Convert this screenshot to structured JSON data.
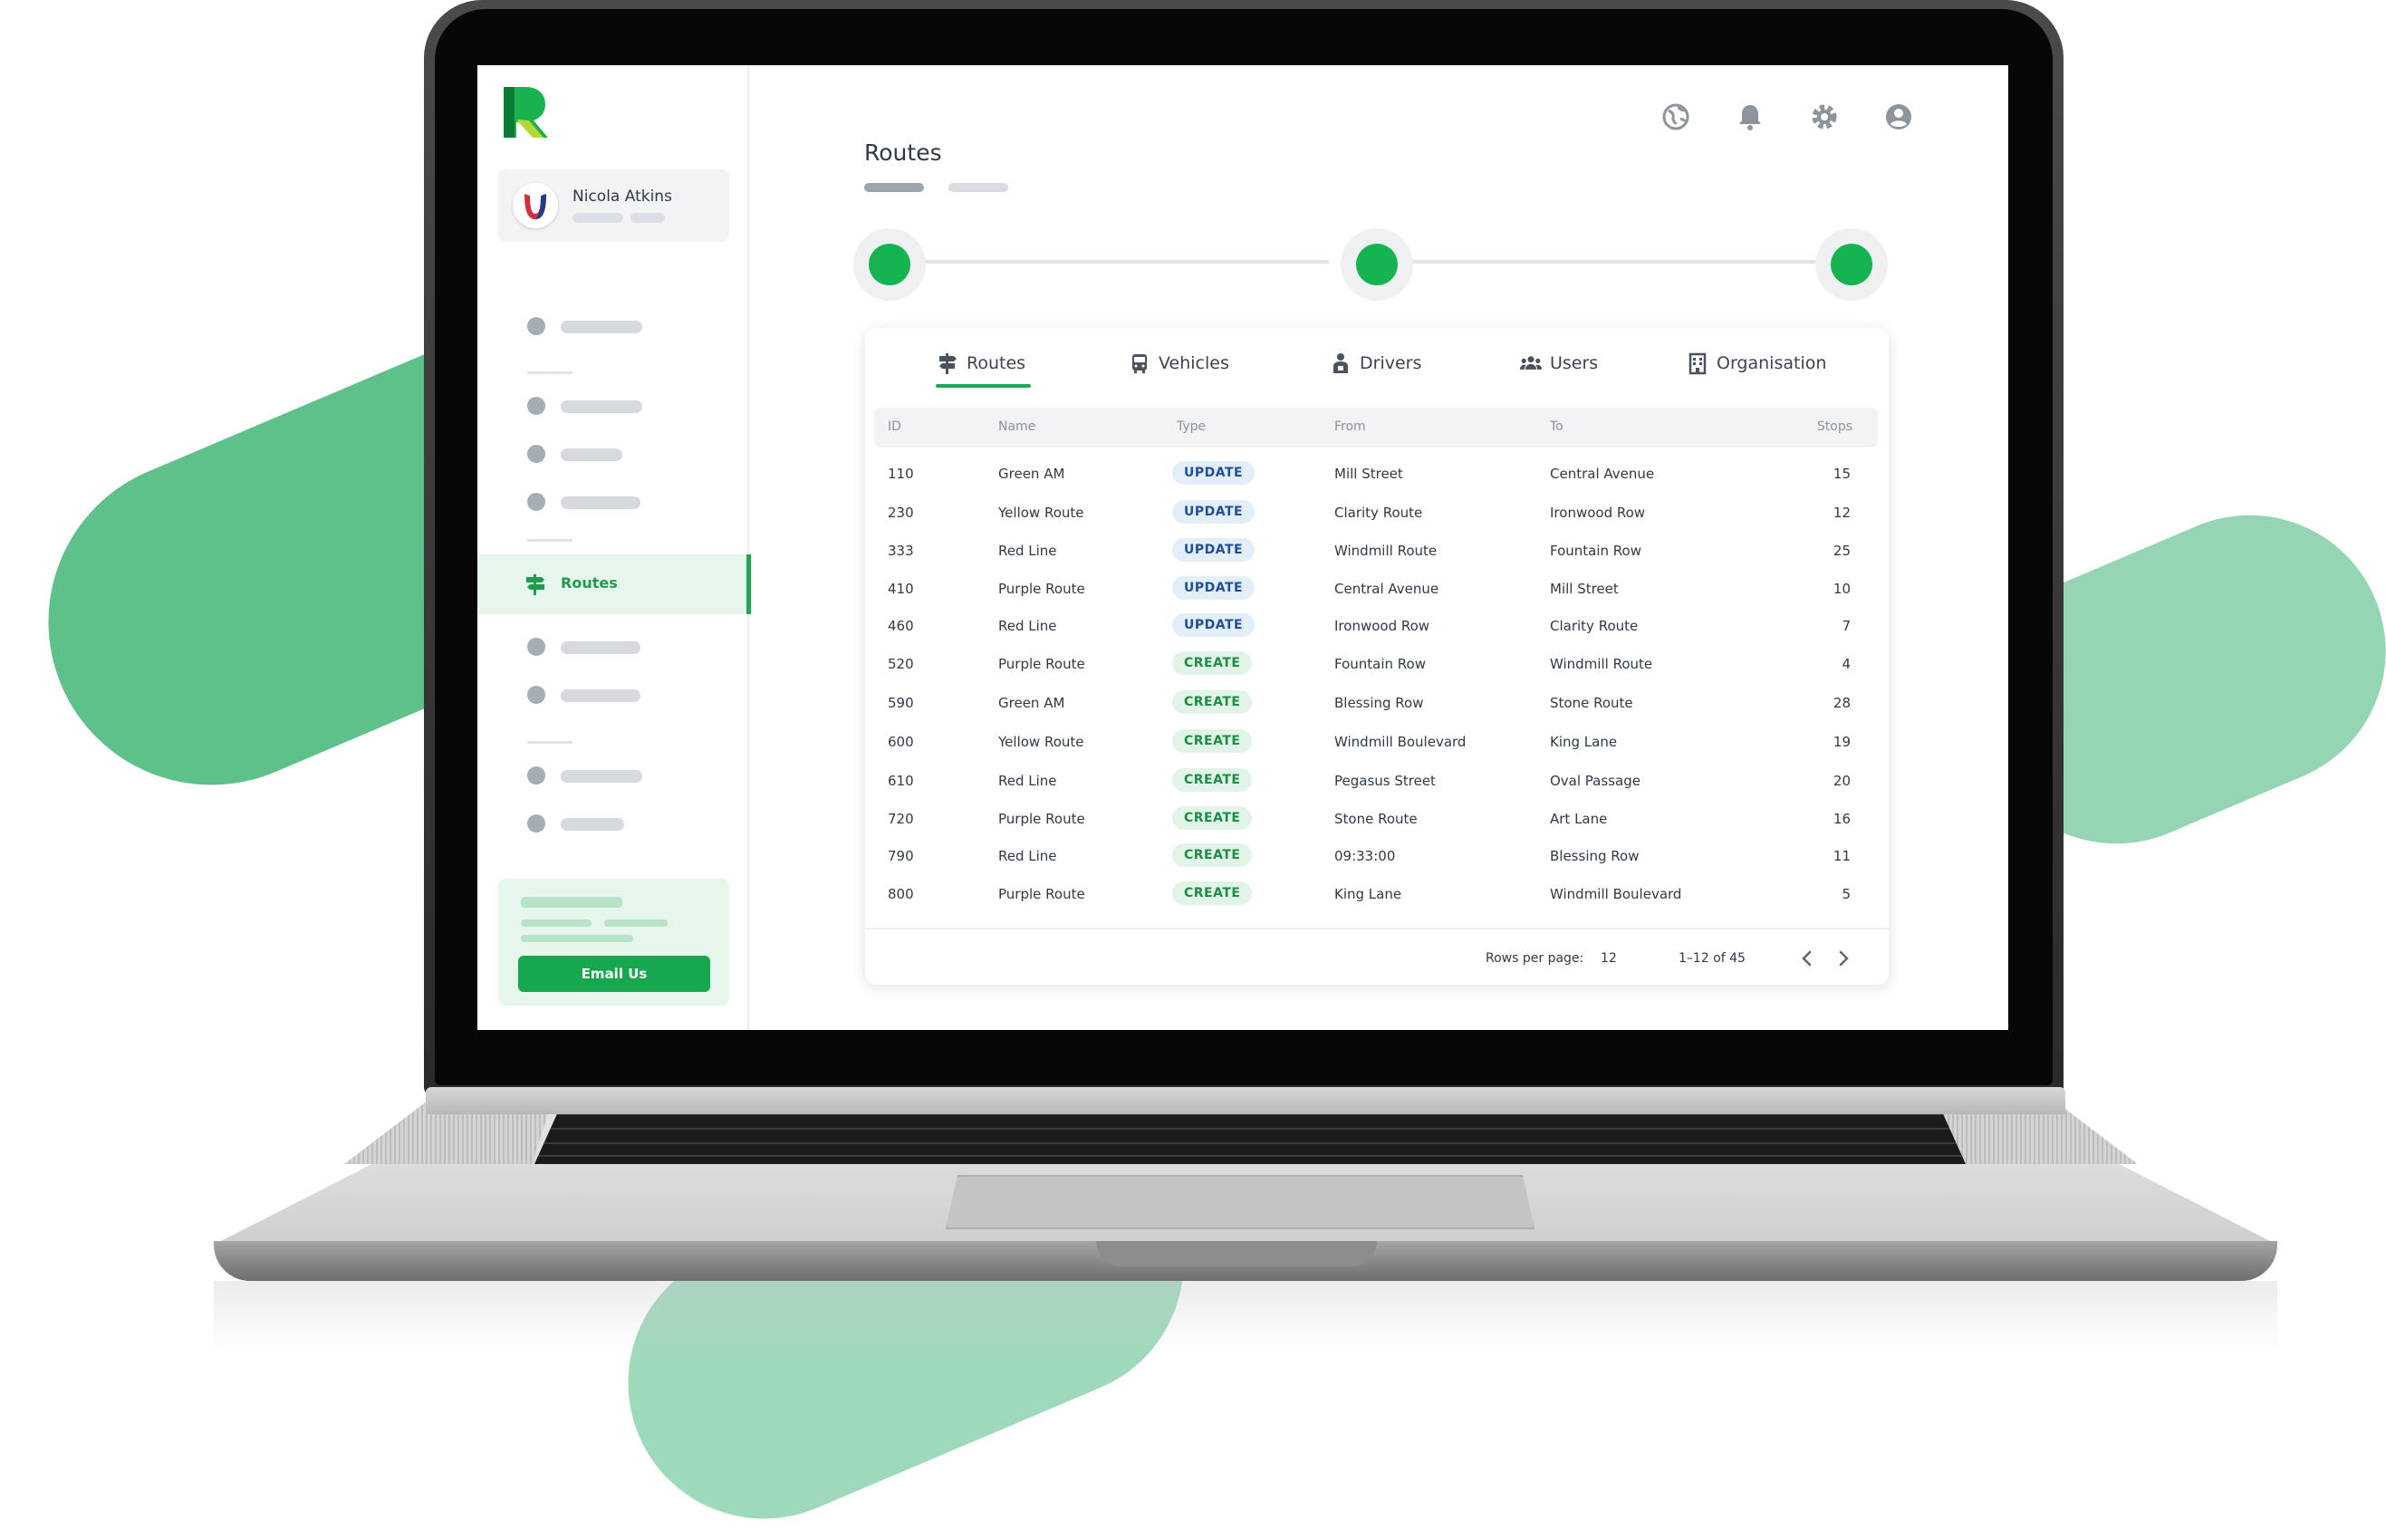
{
  "user": {
    "name": "Nicola Atkins"
  },
  "sidebar": {
    "active_label": "Routes",
    "email_button": "Email Us"
  },
  "page": {
    "title": "Routes"
  },
  "tabs": [
    {
      "label": "Routes",
      "icon": "signpost-icon",
      "active": true
    },
    {
      "label": "Vehicles",
      "icon": "bus-icon"
    },
    {
      "label": "Drivers",
      "icon": "driver-icon"
    },
    {
      "label": "Users",
      "icon": "users-icon"
    },
    {
      "label": "Organisation",
      "icon": "building-icon"
    }
  ],
  "table": {
    "headers": {
      "id": "ID",
      "name": "Name",
      "type": "Type",
      "from": "From",
      "to": "To",
      "stops": "Stops"
    },
    "rows": [
      {
        "id": "110",
        "name": "Green AM",
        "type": "UPDATE",
        "from": "Mill Street",
        "to": "Central Avenue",
        "stops": "15"
      },
      {
        "id": "230",
        "name": "Yellow Route",
        "type": "UPDATE",
        "from": "Clarity Route",
        "to": "Ironwood Row",
        "stops": "12"
      },
      {
        "id": "333",
        "name": "Red Line",
        "type": "UPDATE",
        "from": "Windmill Route",
        "to": "Fountain Row",
        "stops": "25"
      },
      {
        "id": "410",
        "name": "Purple Route",
        "type": "UPDATE",
        "from": "Central Avenue",
        "to": "Mill Street",
        "stops": "10"
      },
      {
        "id": "460",
        "name": "Red Line",
        "type": "UPDATE",
        "from": "Ironwood Row",
        "to": "Clarity Route",
        "stops": "7"
      },
      {
        "id": "520",
        "name": "Purple Route",
        "type": "CREATE",
        "from": "Fountain Row",
        "to": "Windmill Route",
        "stops": "4"
      },
      {
        "id": "590",
        "name": "Green AM",
        "type": "CREATE",
        "from": "Blessing Row",
        "to": "Stone Route",
        "stops": "28"
      },
      {
        "id": "600",
        "name": "Yellow Route",
        "type": "CREATE",
        "from": "Windmill Boulevard",
        "to": "King Lane",
        "stops": "19"
      },
      {
        "id": "610",
        "name": "Red Line",
        "type": "CREATE",
        "from": "Pegasus Street",
        "to": "Oval Passage",
        "stops": "20"
      },
      {
        "id": "720",
        "name": "Purple Route",
        "type": "CREATE",
        "from": "Stone Route",
        "to": "Art Lane",
        "stops": "16"
      },
      {
        "id": "790",
        "name": "Red Line",
        "type": "CREATE",
        "from": "09:33:00",
        "to": "Blessing Row",
        "stops": "11"
      },
      {
        "id": "800",
        "name": "Purple Route",
        "type": "CREATE",
        "from": "King Lane",
        "to": "Windmill Boulevard",
        "stops": "5"
      }
    ]
  },
  "pagination": {
    "rows_per_page_label": "Rows per page:",
    "rows_per_page": "12",
    "range": "1–12 of 45"
  },
  "colors": {
    "accent": "#17a84f",
    "update_badge": "#1f4f9a",
    "create_badge": "#1b8e45"
  }
}
